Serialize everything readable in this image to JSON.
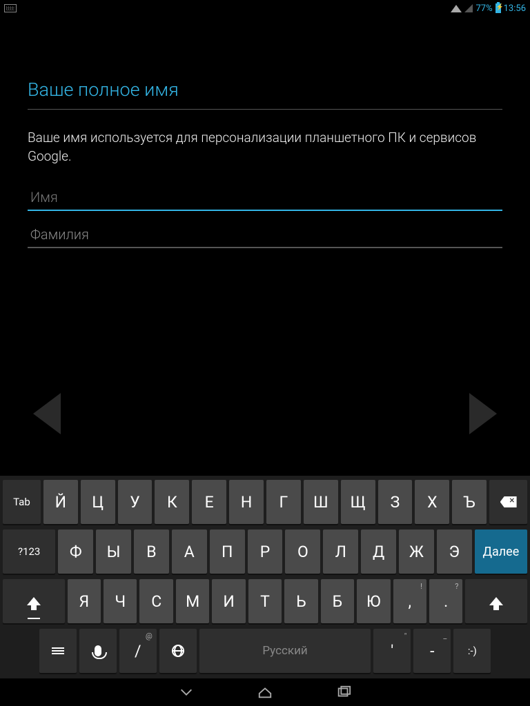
{
  "status": {
    "battery_pct": "77%",
    "time": "13:56"
  },
  "form": {
    "title": "Ваше полное имя",
    "description": "Ваше имя используется для персонализации планшетного ПК и сервисов Google.",
    "first_name_placeholder": "Имя",
    "first_name_value": "",
    "last_name_placeholder": "Фамилия",
    "last_name_value": ""
  },
  "keyboard": {
    "tab": "Tab",
    "sym": "?123",
    "action": "Далее",
    "space_label": "Русский",
    "smiley": ":-)",
    "row1": [
      "Й",
      "Ц",
      "У",
      "К",
      "Е",
      "Н",
      "Г",
      "Ш",
      "Щ",
      "З",
      "Х",
      "Ъ"
    ],
    "row2": [
      "Ф",
      "Ы",
      "В",
      "А",
      "П",
      "Р",
      "О",
      "Л",
      "Д",
      "Ж",
      "Э"
    ],
    "row3": [
      "Я",
      "Ч",
      "С",
      "М",
      "И",
      "Т",
      "Ь",
      "Б",
      "Ю",
      ",",
      "."
    ],
    "row3_sup": [
      "",
      "",
      "",
      "",
      "",
      "",
      "",
      "",
      "",
      "!",
      "?"
    ],
    "slash": "/",
    "slash_sup": "@",
    "apos": "'",
    "apos_sup": "\"",
    "dash": "-",
    "dash_sup": "_"
  }
}
